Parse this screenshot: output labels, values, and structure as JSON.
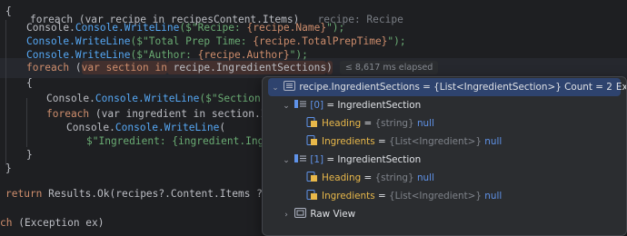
{
  "editor": {
    "lines": {
      "l0": "foreach (var recipe in recipesContent.Items)",
      "l0_comment": "recipe: Recipe",
      "l1": "{",
      "l2_call": "Console.WriteLine",
      "l2_str_a": "($\"Recipe: ",
      "l2_interp": "{recipe.Name}",
      "l2_str_b": "\");",
      "l3_call": "Console.WriteLine",
      "l3_str_a": "($\"Total Prep Time: ",
      "l3_interp": "{recipe.TotalPrepTime}",
      "l3_str_b": "\");",
      "l4_call": "Console.WriteLine",
      "l4_str_a": "($\"Author: ",
      "l4_interp": "{recipe.Author}",
      "l4_str_b": "\");",
      "l5_kw": "foreach",
      "l5_a": " (",
      "l5_var": "var section in",
      "l5_expr": " recipe.IngredientSections",
      "l5_b": ")",
      "l5_elapsed": "≤ 8,617 ms elapsed",
      "l6": "{",
      "l7_call": "Console.WriteLine",
      "l7_str": "($\"Section: {section.Head",
      "l8_kw": "foreach",
      "l8_rest": " (var ingredient in section.Ingredi",
      "l9_call": "Console.WriteLine",
      "l9_rest": "(",
      "l10_str": "$\"Ingredient: {ingredient.Ingredie",
      "l11": "}",
      "l12": "}",
      "l13_kw": "return",
      "l13_rest": " Results.Ok(recipes?.Content.Items ?? []);",
      "l14_kw": "ch",
      "l14_rest": " (Exception ex)"
    }
  },
  "popup": {
    "root": {
      "name": "recipe.IngredientSections",
      "value": " = {List<IngredientSection>} Count = 2",
      "explore": "Explore"
    },
    "items": [
      {
        "index": "[0]",
        "type": "= IngredientSection",
        "children": [
          {
            "name": "Heading",
            "type": "{string}",
            "value": "null"
          },
          {
            "name": "Ingredients",
            "type": "{List<Ingredient>}",
            "value": "null"
          }
        ]
      },
      {
        "index": "[1]",
        "type": "= IngredientSection",
        "children": [
          {
            "name": "Heading",
            "type": "{string}",
            "value": "null"
          },
          {
            "name": "Ingredients",
            "type": "{List<Ingredient>}",
            "value": "null"
          }
        ]
      }
    ],
    "raw_view": "Raw View"
  },
  "colors": {
    "editor_bg": "#1e1f22",
    "popup_bg": "#2b2d30",
    "selection": "#2e436e",
    "keyword": "#cf8e6d",
    "method": "#56a8f5",
    "string": "#6aab73",
    "property": "#c77dbb",
    "null_value": "#5f92e8"
  }
}
